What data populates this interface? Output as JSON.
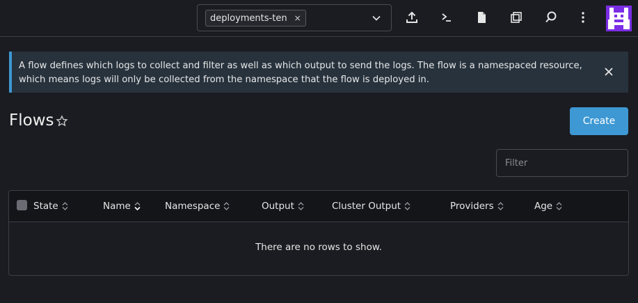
{
  "header": {
    "namespace_chip": "deployments-ten",
    "chip_remove": "×",
    "icons": [
      "upload-icon",
      "terminal-icon",
      "file-icon",
      "copy-icon",
      "search-icon",
      "more-icon",
      "avatar-icon"
    ]
  },
  "banner": {
    "text": "A flow defines which logs to collect and filter as well as which output to send the logs. The flow is a namespaced resource, which means logs will only be collected from the namespace that the flow is deployed in.",
    "close": "×"
  },
  "page": {
    "title": "Flows",
    "create_label": "Create",
    "filter_placeholder": "Filter"
  },
  "table": {
    "columns": [
      "State",
      "Name",
      "Namespace",
      "Output",
      "Cluster Output",
      "Providers",
      "Age"
    ],
    "empty_text": "There are no rows to show."
  },
  "colors": {
    "accent": "#3d98d3",
    "background": "#1b1c21",
    "banner_bg": "#27323d",
    "avatar": "#7b2ee6"
  }
}
